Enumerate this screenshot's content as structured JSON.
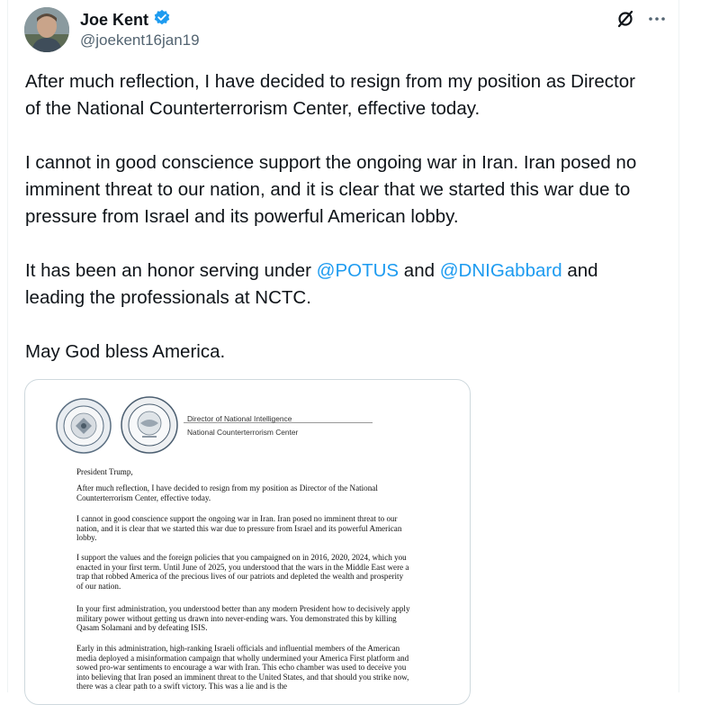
{
  "author": {
    "name": "Joe Kent",
    "handle": "@joekent16jan19",
    "verified_color": "#1d9bf0"
  },
  "post": {
    "p1": "After much reflection, I have decided to resign from my position as Director of the National Counterterrorism Center, effective today.",
    "p2": "I cannot in good conscience support the ongoing war in Iran. Iran posed no imminent threat to our nation, and it is clear that we started this war due to pressure from Israel and its powerful American lobby.",
    "p3_a": "It has been an honor serving under ",
    "p3_m1": "@POTUS",
    "p3_b": " and ",
    "p3_m2": "@DNIGabbard",
    "p3_c": " and leading the professionals at NCTC.",
    "p4": "May God bless America."
  },
  "letter": {
    "org1": "Director of National Intelligence",
    "org2": "National Counterterrorism Center",
    "salutation": "President Trump,",
    "para1": "After much reflection, I have decided to resign from my position as Director of the National Counterterrorism Center, effective today.",
    "para2": "I cannot in good conscience support the ongoing war in Iran. Iran posed no imminent threat to our nation, and it is clear that we started this war due to pressure from Israel and its powerful American lobby.",
    "para3": "I support the values and the foreign policies that you campaigned on in 2016, 2020, 2024, which you enacted in your first term. Until June of 2025, you understood that the wars in the Middle East were a trap that robbed America of the precious lives of our patriots and depleted the wealth and prosperity of our nation.",
    "para4": "In your first administration, you understood better than any modern President how to decisively apply military power without getting us drawn into never-ending wars. You demonstrated this by killing Qasam Solamani and by defeating ISIS.",
    "para5": "Early in this administration, high-ranking Israeli officials and influential members of the American media deployed a misinformation campaign that wholly undermined your America First platform and sowed pro-war sentiments to encourage a war with Iran. This echo chamber was used to deceive you into believing that Iran posed an imminent threat to the United States, and that should you strike now, there was a clear path to a swift victory. This was a lie and is the"
  },
  "icons": {
    "grok": "grok-icon",
    "more": "more-icon",
    "verified": "verified-badge-icon"
  }
}
